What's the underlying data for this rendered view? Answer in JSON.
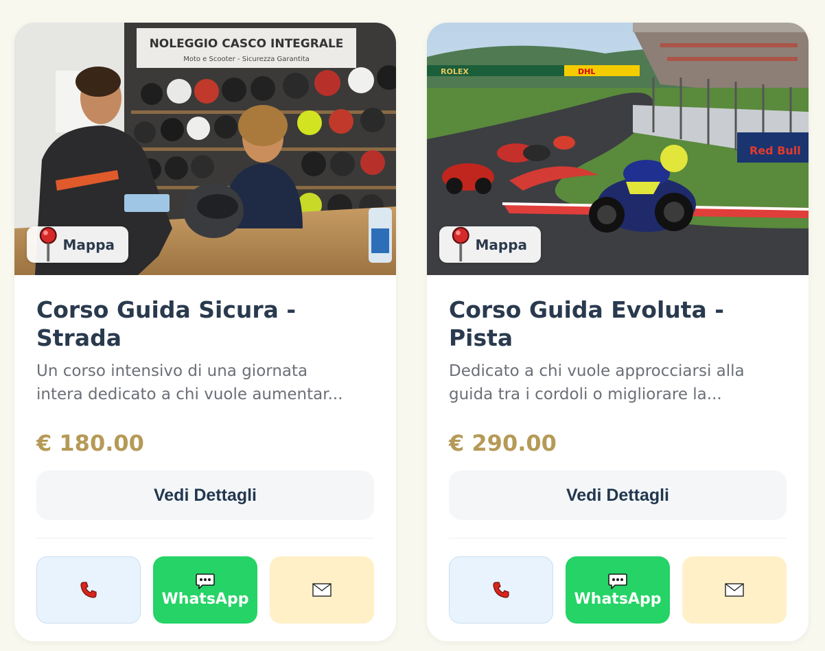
{
  "cards": [
    {
      "map_label": "Mappa",
      "photo_sign_line1": "NOLEGGIO CASCO INTEGRALE",
      "photo_sign_line2": "Moto e Scooter - Sicurezza Garantita",
      "title": "Corso Guida Sicura - Strada",
      "desc_line1": "Un corso intensivo di una giornata",
      "desc_line2": "intera dedicato a chi vuole aumentar...",
      "price": "€ 180.00",
      "details_label": "Vedi Dettagli",
      "whatsapp_label": "WhatsApp"
    },
    {
      "map_label": "Mappa",
      "photo_banner_1": "ROLEX",
      "photo_banner_2": "DHL",
      "photo_banner_3": "Red Bull",
      "title": "Corso Guida Evoluta - Pista",
      "desc_line1": "Dedicato a chi vuole approcciarsi alla",
      "desc_line2": "guida tra i cordoli o migliorare la...",
      "price": "€ 290.00",
      "details_label": "Vedi Dettagli",
      "whatsapp_label": "WhatsApp"
    }
  ],
  "icons": {
    "map": "pin-icon",
    "call": "phone-icon",
    "whatsapp": "chat-bubble-icon",
    "email": "envelope-icon"
  },
  "colors": {
    "title": "#2a3a4e",
    "price": "#b59a57",
    "whatsapp": "#25d366",
    "phone_bg": "#e8f3fd",
    "mail_bg": "#fff0c8"
  }
}
